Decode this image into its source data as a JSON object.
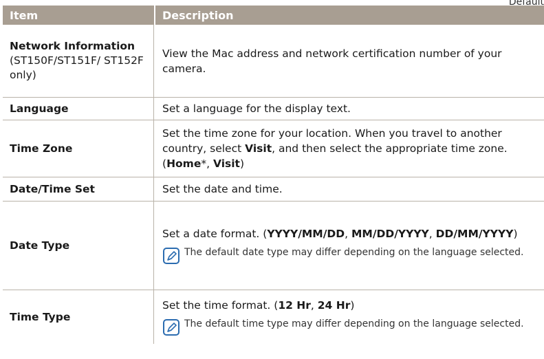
{
  "corner_text": "Default",
  "header": {
    "col1": "Item",
    "col2": "Description"
  },
  "rows": [
    {
      "item": "Network Information",
      "item_sub": "(ST150F/ST151F/ ST152F only)",
      "desc": "View the Mac address and network certification number of your camera."
    },
    {
      "item": "Language",
      "desc": "Set a language for the display text."
    },
    {
      "item": "Time Zone",
      "desc_a": "Set the time zone for your location. When you travel to another country, select ",
      "desc_b": "Visit",
      "desc_c": ", and then select the appropriate time zone. (",
      "desc_d": "Home",
      "desc_e": "*, ",
      "desc_f": "Visit",
      "desc_g": ")"
    },
    {
      "item": "Date/Time Set",
      "desc": "Set the date and time."
    },
    {
      "item": "Date Type",
      "desc_a": "Set a date format. (",
      "desc_b": "YYYY/MM/DD",
      "desc_c": ", ",
      "desc_d": "MM/DD/YYYY",
      "desc_e": ", ",
      "desc_f": "DD/MM/YYYY",
      "desc_g": ")",
      "note": "The default date type may differ depending on the language selected."
    },
    {
      "item": "Time Type",
      "desc_a": "Set the time format. (",
      "desc_b": "12 Hr",
      "desc_c": ", ",
      "desc_d": "24 Hr",
      "desc_e": ")",
      "note": "The default time type may differ depending on the language selected."
    }
  ],
  "colors": {
    "header_bg": "#a89e92",
    "rule": "#b9b2a8",
    "note_icon": "#2b6cb0"
  }
}
